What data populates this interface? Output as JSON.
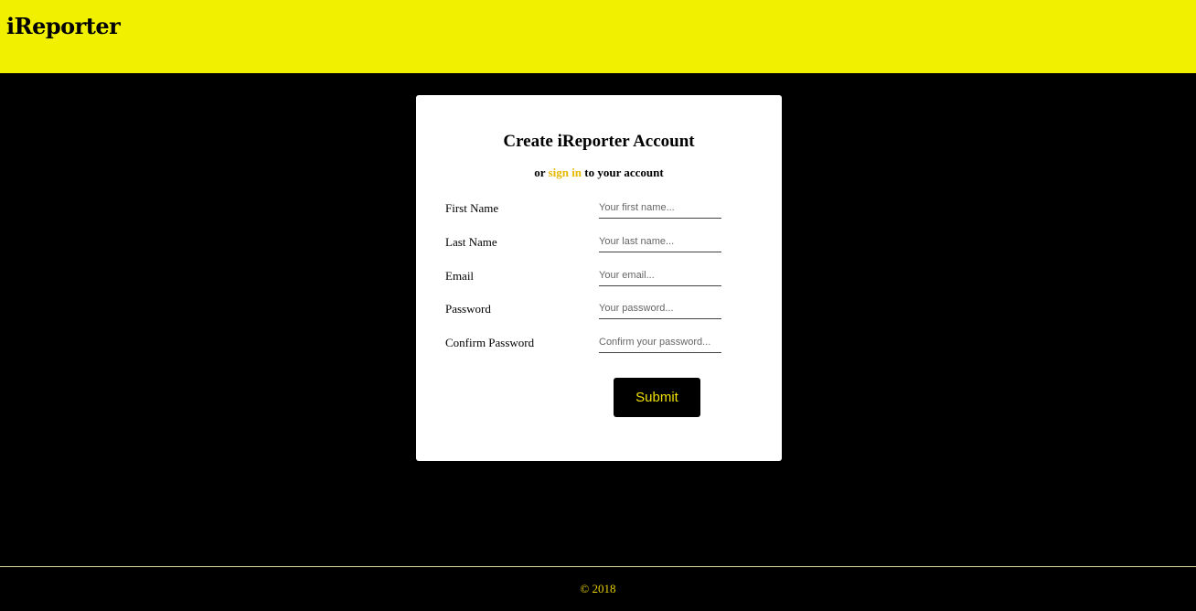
{
  "header": {
    "logo": "iReporter"
  },
  "form": {
    "title": "Create iReporter Account",
    "subtitle_prefix": "or",
    "subtitle_link": "sign in",
    "subtitle_suffix": "to your account",
    "fields": [
      {
        "label": "First Name",
        "placeholder": "Your first name..."
      },
      {
        "label": "Last Name",
        "placeholder": "Your last name..."
      },
      {
        "label": "Email",
        "placeholder": "Your email..."
      },
      {
        "label": "Password",
        "placeholder": "Your password..."
      },
      {
        "label": "Confirm Password",
        "placeholder": "Confirm your password..."
      }
    ],
    "submit_label": "Submit"
  },
  "footer": {
    "text": "© 2018"
  },
  "colors": {
    "header_bg": "#f0f000",
    "page_bg": "#000000",
    "accent": "#e6b800",
    "button_text": "#f0e000"
  }
}
